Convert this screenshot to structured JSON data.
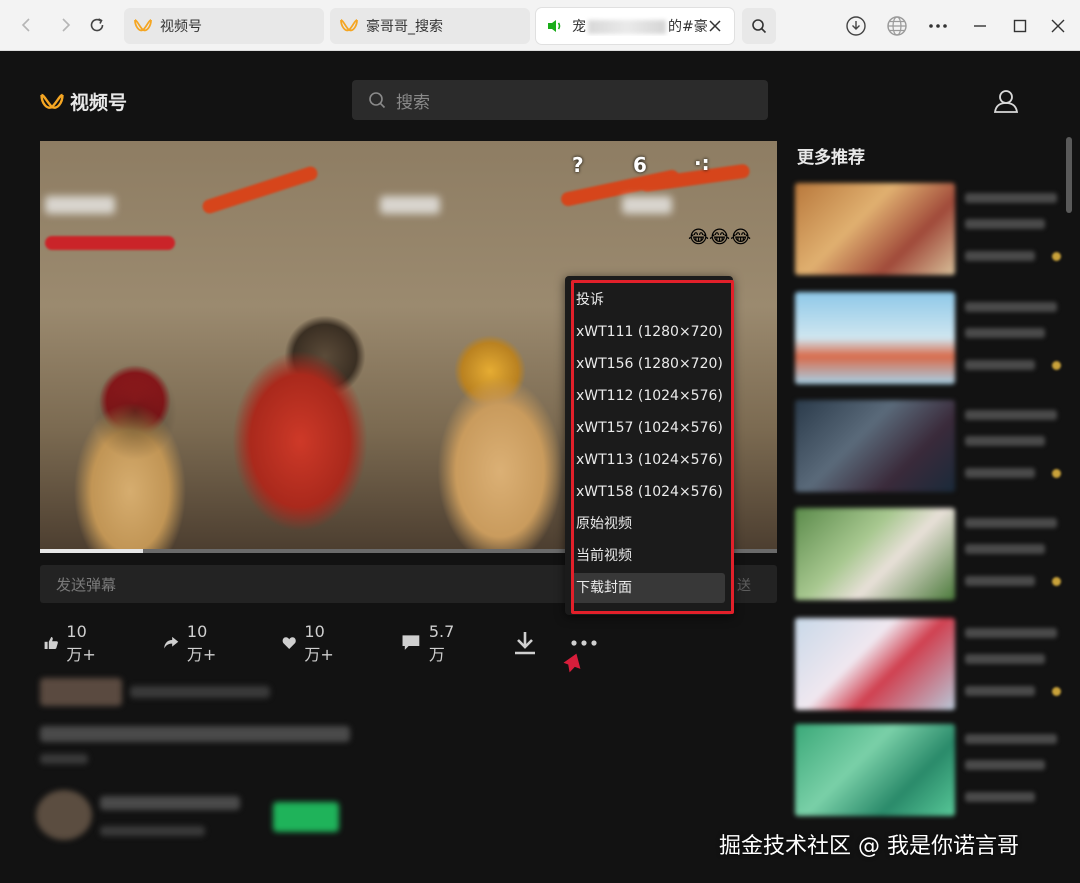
{
  "browser": {
    "tabs": [
      {
        "label": "视频号"
      },
      {
        "label": "豪哥哥_搜索"
      },
      {
        "label_prefix": "宠",
        "label_suffix": "的#豪"
      }
    ]
  },
  "header": {
    "logo_text": "视频号",
    "search_placeholder": "搜索"
  },
  "video": {
    "overlay": {
      "q": "?",
      "num": "6",
      "dots": "·:"
    },
    "progress": 0.14,
    "danmaku_placeholder": "发送弹幕",
    "danmaku_send": "送"
  },
  "actions": [
    {
      "icon": "thumb-up-icon",
      "label": "10万+"
    },
    {
      "icon": "share-icon",
      "label": "10万+"
    },
    {
      "icon": "heart-icon",
      "label": "10万+"
    },
    {
      "icon": "comment-icon",
      "label": "5.7万"
    },
    {
      "icon": "download-icon",
      "label": ""
    },
    {
      "icon": "more-icon",
      "label": ""
    }
  ],
  "menu": {
    "items": [
      "投诉",
      "xWT111 (1280×720)",
      "xWT156 (1280×720)",
      "xWT112 (1024×576)",
      "xWT157 (1024×576)",
      "xWT113 (1024×576)",
      "xWT158 (1024×576)",
      "原始视频",
      "当前视频",
      "下载封面"
    ],
    "highlight_color": "#e2202a"
  },
  "sidebar": {
    "title": "更多推荐"
  },
  "watermark": "掘金技术社区 @ 我是你诺言哥",
  "colors": {
    "background": "#121212",
    "accent": "#f5a623",
    "follow_button": "#1fb35a"
  }
}
